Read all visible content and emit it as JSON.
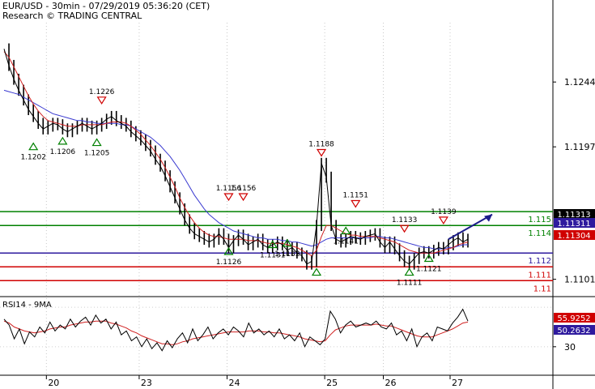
{
  "header": {
    "title": "EUR/USD - 30min - 07/29/2019 05:36:20 (CET)",
    "research": "Research © TRADING CENTRAL"
  },
  "rsi_label": "RSI14 - 9MA",
  "chart_data": [
    {
      "type": "line",
      "name": "price",
      "ylim": [
        1.1089,
        1.1287
      ],
      "y_ticks": [
        {
          "value": 1.1244,
          "label": "1.1244"
        },
        {
          "value": 1.1197,
          "label": "1.1197"
        },
        {
          "value": 1.1101,
          "label": "1.1101"
        }
      ],
      "x_ticks": [
        "20",
        "23",
        "24",
        "25",
        "26",
        "27"
      ],
      "close_series": [
        1.1268,
        1.1256,
        1.1246,
        1.1238,
        1.1231,
        1.1224,
        1.1219,
        1.1214,
        1.121,
        1.1212,
        1.1214,
        1.1213,
        1.121,
        1.1208,
        1.121,
        1.1212,
        1.1214,
        1.1212,
        1.121,
        1.1212,
        1.1214,
        1.1217,
        1.1219,
        1.1216,
        1.1214,
        1.1212,
        1.1208,
        1.1205,
        1.1202,
        1.1198,
        1.1194,
        1.1188,
        1.1183,
        1.1176,
        1.1168,
        1.116,
        1.1152,
        1.1144,
        1.1138,
        1.1134,
        1.1132,
        1.113,
        1.1128,
        1.113,
        1.1134,
        1.113,
        1.1124,
        1.1129,
        1.1133,
        1.113,
        1.1126,
        1.1128,
        1.113,
        1.1126,
        1.1124,
        1.1126,
        1.1128,
        1.1126,
        1.1122,
        1.1124,
        1.112,
        1.1118,
        1.1112,
        1.1114,
        1.114,
        1.1185,
        1.1175,
        1.114,
        1.113,
        1.1128,
        1.113,
        1.1132,
        1.1131,
        1.113,
        1.1132,
        1.1133,
        1.1134,
        1.1128,
        1.1124,
        1.1128,
        1.1123,
        1.1118,
        1.1114,
        1.1112,
        1.1116,
        1.112,
        1.1121,
        1.112,
        1.1122,
        1.1124,
        1.1123,
        1.1126,
        1.1129,
        1.1131,
        1.1128,
        1.113
      ],
      "ma_fast": [
        1.1266,
        1.1262,
        1.1255,
        1.1248,
        1.1241,
        1.1234,
        1.1228,
        1.1223,
        1.1219,
        1.1216,
        1.1215,
        1.1214,
        1.1213,
        1.1212,
        1.1212,
        1.1212,
        1.1213,
        1.1213,
        1.1213,
        1.1213,
        1.1213,
        1.1214,
        1.1215,
        1.1215,
        1.1215,
        1.1214,
        1.1212,
        1.1209,
        1.1206,
        1.1202,
        1.1198,
        1.1193,
        1.1188,
        1.1182,
        1.1175,
        1.1168,
        1.116,
        1.1153,
        1.1147,
        1.1142,
        1.1138,
        1.1135,
        1.1133,
        1.1132,
        1.1132,
        1.1131,
        1.113,
        1.113,
        1.113,
        1.113,
        1.1129,
        1.1129,
        1.1129,
        1.1128,
        1.1127,
        1.1127,
        1.1127,
        1.1127,
        1.1126,
        1.1125,
        1.1124,
        1.1122,
        1.112,
        1.1118,
        1.1122,
        1.1132,
        1.114,
        1.114,
        1.1138,
        1.1136,
        1.1134,
        1.1133,
        1.1133,
        1.1132,
        1.1132,
        1.1132,
        1.1132,
        1.1131,
        1.113,
        1.1129,
        1.1128,
        1.1126,
        1.1124,
        1.1122,
        1.1121,
        1.112,
        1.112,
        1.112,
        1.112,
        1.1121,
        1.1122,
        1.1123,
        1.1124,
        1.1126,
        1.1127,
        1.1128
      ],
      "ma_slow": [
        1.1238,
        1.1237,
        1.1236,
        1.1235,
        1.1233,
        1.1231,
        1.1229,
        1.1227,
        1.1225,
        1.1223,
        1.1221,
        1.122,
        1.1219,
        1.1218,
        1.1217,
        1.1216,
        1.1216,
        1.1215,
        1.1215,
        1.1214,
        1.1214,
        1.1214,
        1.1214,
        1.1214,
        1.1213,
        1.1213,
        1.1212,
        1.121,
        1.1208,
        1.1206,
        1.1204,
        1.1201,
        1.1198,
        1.1194,
        1.119,
        1.1185,
        1.118,
        1.1174,
        1.1168,
        1.1162,
        1.1157,
        1.1152,
        1.1148,
        1.1145,
        1.1142,
        1.114,
        1.1138,
        1.1136,
        1.1135,
        1.1134,
        1.1133,
        1.1132,
        1.1131,
        1.1131,
        1.113,
        1.113,
        1.113,
        1.1129,
        1.1129,
        1.1128,
        1.1128,
        1.1127,
        1.1126,
        1.1125,
        1.1126,
        1.1128,
        1.113,
        1.1131,
        1.1131,
        1.1131,
        1.1131,
        1.1131,
        1.1131,
        1.1131,
        1.1131,
        1.1131,
        1.1132,
        1.1132,
        1.1131,
        1.1131,
        1.113,
        1.1129,
        1.1128,
        1.1127,
        1.1126,
        1.1125,
        1.1124,
        1.1124,
        1.1123,
        1.1123,
        1.1123,
        1.1124,
        1.1124,
        1.1125,
        1.1126,
        1.1126
      ],
      "horizontal_levels": [
        {
          "value": 1.115,
          "label": "1.115",
          "color": "#008000"
        },
        {
          "value": 1.114,
          "label": "1.114",
          "color": "#008000"
        },
        {
          "value": 1.112,
          "label": "1.112",
          "color": "#2e1a9e"
        },
        {
          "value": 1.111,
          "label": "1.111",
          "color": "#d00000"
        },
        {
          "value": 1.11,
          "label": "1.11",
          "color": "#d00000"
        }
      ],
      "price_tags": [
        {
          "value": 1.11313,
          "label": "1.11313",
          "bg": "#000000"
        },
        {
          "value": 1.11311,
          "label": "1.11311",
          "bg": "#2e1a9e"
        },
        {
          "value": 1.11304,
          "label": "1.11304",
          "bg": "#d00000"
        }
      ],
      "peaks": [
        {
          "i": 20,
          "value": 1.1226,
          "label": "1.1226"
        },
        {
          "i": 65,
          "value": 1.1188,
          "label": "1.1188"
        },
        {
          "i": 46,
          "value": 1.1156,
          "label": "1.1156"
        },
        {
          "i": 49,
          "value": 1.1156,
          "label": "1.1156"
        },
        {
          "i": 72,
          "value": 1.1151,
          "label": "1.1151"
        },
        {
          "i": 82,
          "value": 1.1133,
          "label": "1.1133"
        },
        {
          "i": 90,
          "value": 1.1139,
          "label": "1.1139"
        }
      ],
      "troughs": [
        {
          "i": 6,
          "value": 1.1202,
          "label": "1.1202"
        },
        {
          "i": 12,
          "value": 1.1206,
          "label": "1.1206"
        },
        {
          "i": 19,
          "value": 1.1205,
          "label": "1.1205"
        },
        {
          "i": 46,
          "value": 1.1126,
          "label": "1.1126"
        },
        {
          "i": 55,
          "value": 1.1131,
          "label": "1.1131"
        },
        {
          "i": 58,
          "value": 1.1132,
          "label": "1.1132"
        },
        {
          "i": 64,
          "value": 1.1111,
          "label": ""
        },
        {
          "i": 70,
          "value": 1.1141,
          "label": "1.1141"
        },
        {
          "i": 83,
          "value": 1.1111,
          "label": "1.1111"
        },
        {
          "i": 87,
          "value": 1.1121,
          "label": "1.1121"
        }
      ],
      "projection": {
        "from_i": 91,
        "from_value": 1.113,
        "to_value": 1.1148,
        "color": "#1c1c8a"
      }
    },
    {
      "type": "line",
      "name": "RSI14 - 9MA",
      "ylim": [
        20,
        80
      ],
      "y_ticks": [
        {
          "value": 30,
          "label": "30"
        }
      ],
      "rsi": [
        58,
        52,
        38,
        48,
        33,
        45,
        40,
        50,
        44,
        55,
        46,
        52,
        48,
        58,
        50,
        56,
        60,
        52,
        62,
        54,
        58,
        48,
        55,
        42,
        46,
        36,
        40,
        30,
        38,
        28,
        34,
        26,
        36,
        29,
        38,
        44,
        34,
        48,
        36,
        42,
        50,
        38,
        44,
        48,
        42,
        50,
        46,
        40,
        54,
        44,
        48,
        42,
        46,
        40,
        48,
        38,
        42,
        36,
        44,
        30,
        40,
        36,
        32,
        38,
        66,
        58,
        44,
        52,
        56,
        50,
        52,
        54,
        52,
        56,
        50,
        48,
        54,
        42,
        46,
        36,
        48,
        30,
        40,
        44,
        36,
        50,
        48,
        46,
        54,
        60,
        68,
        56
      ],
      "rsi_ma": [
        56,
        54,
        50,
        48,
        46,
        45,
        44,
        45,
        46,
        48,
        49,
        50,
        50,
        52,
        53,
        54,
        55,
        55,
        56,
        56,
        56,
        54,
        53,
        51,
        49,
        46,
        44,
        41,
        39,
        37,
        35,
        33,
        33,
        32,
        33,
        35,
        36,
        38,
        39,
        40,
        41,
        42,
        43,
        44,
        45,
        45,
        45,
        45,
        46,
        46,
        46,
        45,
        45,
        44,
        44,
        43,
        42,
        41,
        40,
        38,
        37,
        36,
        35,
        36,
        42,
        47,
        49,
        51,
        52,
        52,
        52,
        52,
        52,
        53,
        52,
        51,
        51,
        49,
        47,
        45,
        43,
        41,
        40,
        40,
        40,
        42,
        44,
        46,
        48,
        51,
        54,
        55
      ],
      "tags": [
        {
          "value": 55.9252,
          "label": "55.9252",
          "bg": "#d00000"
        },
        {
          "value": 50.2632,
          "label": "50.2632",
          "bg": "#2e1a9e"
        }
      ]
    }
  ]
}
